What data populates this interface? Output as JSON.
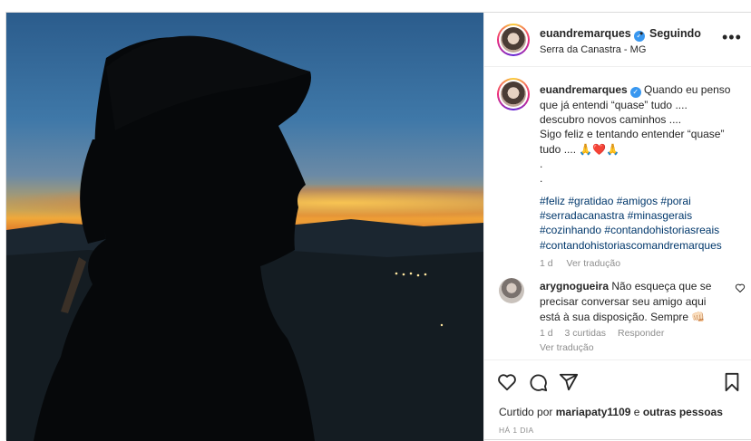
{
  "post": {
    "author": "euandremarques",
    "follow_status": "Seguindo",
    "separator": "•",
    "location": "Serra da Canastra - MG",
    "more": "•••",
    "verified_mark": "✓"
  },
  "caption": {
    "username": "euandremarques",
    "text_lines": [
      "Quando eu penso",
      "que já entendi “quase” tudo ....",
      "descubro novos caminhos ....",
      "Sigo feliz e tentando entender “quase”",
      "tudo .... 🙏❤️🙏",
      ".",
      "."
    ],
    "hashtags": [
      "#feliz #gratidao #amigos #porai",
      "#serradacanastra #minasgerais",
      "#cozinhando #contandohistoriasreais",
      "#contandohistoriascomandremarques"
    ],
    "time": "1 d",
    "translate": "Ver tradução"
  },
  "comment": {
    "username": "arygnogueira",
    "text": "Não esqueça que se precisar conversar seu amigo aqui está à sua disposição. Sempre 👊🏻",
    "time": "1 d",
    "likes": "3 curtidas",
    "reply": "Responder",
    "translate": "Ver tradução"
  },
  "footer": {
    "liked_prefix": "Curtido por",
    "liked_user": "mariapaty1109",
    "liked_joiner": "e",
    "liked_others": "outras pessoas",
    "time_ago": "HÁ 1 DIA"
  },
  "icons": [
    "like-heart-icon",
    "comment-icon",
    "share-icon",
    "save-bookmark-icon",
    "verified-badge-icon",
    "more-options-icon"
  ],
  "colors": {
    "verified": "#3897f0",
    "hashtag": "#00376b",
    "muted": "#8e8e8e",
    "text": "#262626"
  }
}
